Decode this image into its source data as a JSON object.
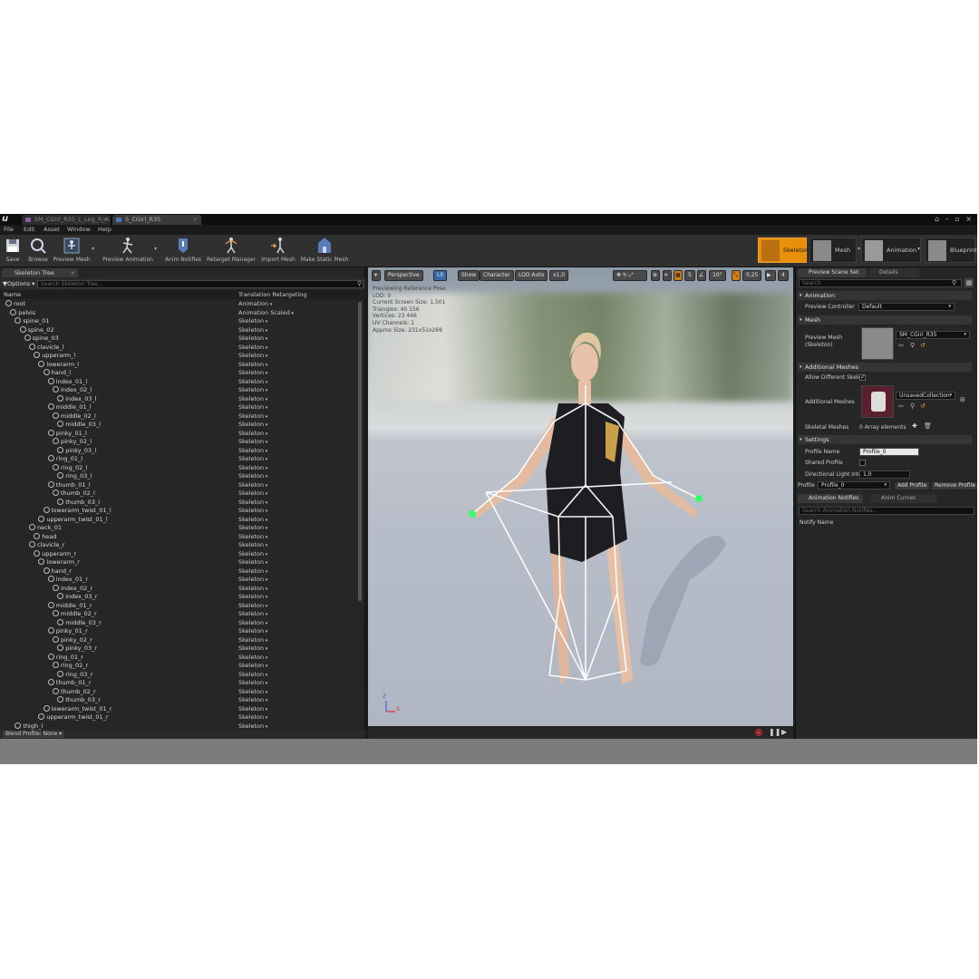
{
  "tabs": [
    {
      "label": "SM_CGirl_R35_L_Leg_R_A",
      "active": false
    },
    {
      "label": "S_CGirl_R35",
      "active": true
    }
  ],
  "menu": [
    "File",
    "Edit",
    "Asset",
    "Window",
    "Help"
  ],
  "toolbar": {
    "save": "Save",
    "browse": "Browse",
    "preview_mesh": "Preview Mesh",
    "preview_animation": "Preview Animation",
    "anim_notifies": "Anim Notifies",
    "retarget_manager": "Retarget Manager",
    "import_mesh": "Import Mesh",
    "make_static_mesh": "Make Static Mesh"
  },
  "modes": [
    {
      "label": "Skeleton",
      "active": true
    },
    {
      "label": "Mesh",
      "active": false
    },
    {
      "label": "Animation",
      "active": false
    },
    {
      "label": "Blueprint",
      "active": false
    }
  ],
  "skeleton_tree": {
    "tab": "Skeleton Tree",
    "options": "Options",
    "search_placeholder": "Search Skeleton Tree...",
    "col_name": "Name",
    "col_retarget": "Translation Retargeting",
    "bones": [
      {
        "name": "root",
        "depth": 0,
        "rt": "Animation"
      },
      {
        "name": "pelvis",
        "depth": 1,
        "rt": "Animation Scaled"
      },
      {
        "name": "spine_01",
        "depth": 2,
        "rt": "Skeleton"
      },
      {
        "name": "spine_02",
        "depth": 3,
        "rt": "Skeleton"
      },
      {
        "name": "spine_03",
        "depth": 4,
        "rt": "Skeleton"
      },
      {
        "name": "clavicle_l",
        "depth": 5,
        "rt": "Skeleton"
      },
      {
        "name": "upperarm_l",
        "depth": 6,
        "rt": "Skeleton"
      },
      {
        "name": "lowerarm_l",
        "depth": 7,
        "rt": "Skeleton"
      },
      {
        "name": "hand_l",
        "depth": 8,
        "rt": "Skeleton"
      },
      {
        "name": "index_01_l",
        "depth": 9,
        "rt": "Skeleton"
      },
      {
        "name": "index_02_l",
        "depth": 10,
        "rt": "Skeleton"
      },
      {
        "name": "index_03_l",
        "depth": 11,
        "rt": "Skeleton"
      },
      {
        "name": "middle_01_l",
        "depth": 9,
        "rt": "Skeleton"
      },
      {
        "name": "middle_02_l",
        "depth": 10,
        "rt": "Skeleton"
      },
      {
        "name": "middle_03_l",
        "depth": 11,
        "rt": "Skeleton"
      },
      {
        "name": "pinky_01_l",
        "depth": 9,
        "rt": "Skeleton"
      },
      {
        "name": "pinky_02_l",
        "depth": 10,
        "rt": "Skeleton"
      },
      {
        "name": "pinky_03_l",
        "depth": 11,
        "rt": "Skeleton"
      },
      {
        "name": "ring_01_l",
        "depth": 9,
        "rt": "Skeleton"
      },
      {
        "name": "ring_02_l",
        "depth": 10,
        "rt": "Skeleton"
      },
      {
        "name": "ring_03_l",
        "depth": 11,
        "rt": "Skeleton"
      },
      {
        "name": "thumb_01_l",
        "depth": 9,
        "rt": "Skeleton"
      },
      {
        "name": "thumb_02_l",
        "depth": 10,
        "rt": "Skeleton"
      },
      {
        "name": "thumb_03_l",
        "depth": 11,
        "rt": "Skeleton"
      },
      {
        "name": "lowerarm_twist_01_l",
        "depth": 8,
        "rt": "Skeleton"
      },
      {
        "name": "upperarm_twist_01_l",
        "depth": 7,
        "rt": "Skeleton"
      },
      {
        "name": "neck_01",
        "depth": 5,
        "rt": "Skeleton"
      },
      {
        "name": "head",
        "depth": 6,
        "rt": "Skeleton"
      },
      {
        "name": "clavicle_r",
        "depth": 5,
        "rt": "Skeleton"
      },
      {
        "name": "upperarm_r",
        "depth": 6,
        "rt": "Skeleton"
      },
      {
        "name": "lowerarm_r",
        "depth": 7,
        "rt": "Skeleton"
      },
      {
        "name": "hand_r",
        "depth": 8,
        "rt": "Skeleton"
      },
      {
        "name": "index_01_r",
        "depth": 9,
        "rt": "Skeleton"
      },
      {
        "name": "index_02_r",
        "depth": 10,
        "rt": "Skeleton"
      },
      {
        "name": "index_03_r",
        "depth": 11,
        "rt": "Skeleton"
      },
      {
        "name": "middle_01_r",
        "depth": 9,
        "rt": "Skeleton"
      },
      {
        "name": "middle_02_r",
        "depth": 10,
        "rt": "Skeleton"
      },
      {
        "name": "middle_03_r",
        "depth": 11,
        "rt": "Skeleton"
      },
      {
        "name": "pinky_01_r",
        "depth": 9,
        "rt": "Skeleton"
      },
      {
        "name": "pinky_02_r",
        "depth": 10,
        "rt": "Skeleton"
      },
      {
        "name": "pinky_03_r",
        "depth": 11,
        "rt": "Skeleton"
      },
      {
        "name": "ring_01_r",
        "depth": 9,
        "rt": "Skeleton"
      },
      {
        "name": "ring_02_r",
        "depth": 10,
        "rt": "Skeleton"
      },
      {
        "name": "ring_03_r",
        "depth": 11,
        "rt": "Skeleton"
      },
      {
        "name": "thumb_01_r",
        "depth": 9,
        "rt": "Skeleton"
      },
      {
        "name": "thumb_02_r",
        "depth": 10,
        "rt": "Skeleton"
      },
      {
        "name": "thumb_03_r",
        "depth": 11,
        "rt": "Skeleton"
      },
      {
        "name": "lowerarm_twist_01_r",
        "depth": 8,
        "rt": "Skeleton"
      },
      {
        "name": "upperarm_twist_01_r",
        "depth": 7,
        "rt": "Skeleton"
      },
      {
        "name": "thigh_l",
        "depth": 2,
        "rt": "Skeleton"
      }
    ],
    "blend_profile": "Blend Profile: None"
  },
  "viewport": {
    "perspective": "Perspective",
    "lit": "Lit",
    "show": "Show",
    "character": "Character",
    "lod": "LOD Auto",
    "speed": "x1,0",
    "snap_grid": "5",
    "snap_angle": "10°",
    "snap_scale": "0,25",
    "camera_speed": "4",
    "stats": [
      "Previewing Reference Pose",
      "LOD: 0",
      "Current Screen Size: 1,501",
      "Triangles: 40 156",
      "Vertices: 23 446",
      "UV Channels: 1",
      "Approx Size: 231x51x269"
    ],
    "axis_z": "Z",
    "axis_x": "X"
  },
  "right_panel": {
    "tab_scene": "Preview Scene Set",
    "tab_details": "Details",
    "search_placeholder": "Search",
    "sec_animation": "Animation",
    "preview_controller_label": "Preview Controller",
    "preview_controller_value": "Default",
    "sec_mesh": "Mesh",
    "preview_mesh_label": "Preview Mesh (Skeleton)",
    "preview_mesh_value": "SM_CGirl_R35",
    "sec_additional": "Additional Meshes",
    "allow_diff_label": "Allow Different Skele",
    "additional_meshes_label": "Additional Meshes",
    "additional_meshes_value": "UnsavedCollection",
    "skeletal_meshes_label": "Skeletal Meshes",
    "skeletal_meshes_value": "0 Array elements",
    "sec_settings": "Settings",
    "profile_name_label": "Profile Name",
    "profile_name_value": "Profile_0",
    "shared_profile_label": "Shared Profile",
    "dir_light_label": "Directional Light Inte",
    "dir_light_value": "1,0",
    "profile_label": "Profile",
    "profile_value": "Profile_0",
    "add_profile": "Add Profile",
    "remove_profile": "Remove Profile",
    "tab_notifies": "Animation Notifies",
    "tab_curves": "Anim Curves",
    "notify_search_placeholder": "Search Animation Notifies...",
    "notify_col": "Notify Name"
  },
  "colors": {
    "accent": "#e8900a",
    "bone": "#ffffff",
    "selection_blue": "#3b6aa8"
  }
}
